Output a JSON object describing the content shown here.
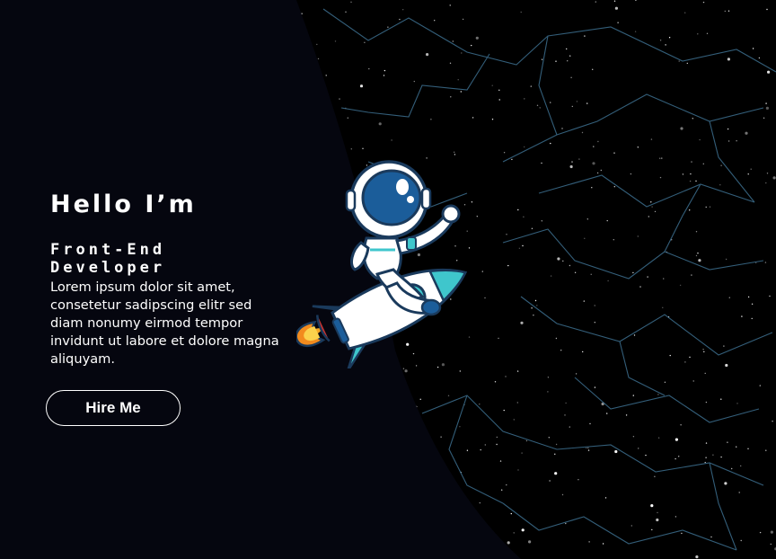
{
  "hero": {
    "greeting": "Hello I’m",
    "role_line1": "Front-End",
    "role_line2": "Developer",
    "bio": "Lorem ipsum dolor sit amet, consetetur sadipscing elitr sed diam nonumy eirmod tempor invidunt ut labore et dolore magna aliquyam.",
    "cta_label": "Hire Me"
  },
  "colors": {
    "panel": "#05060f",
    "space": "#000000",
    "helmet": "#1b5d9a",
    "rocket_teal": "#3fc6cc",
    "flame": "#f5a623"
  },
  "icons": {
    "illustration": "astronaut-rocket-illustration"
  }
}
